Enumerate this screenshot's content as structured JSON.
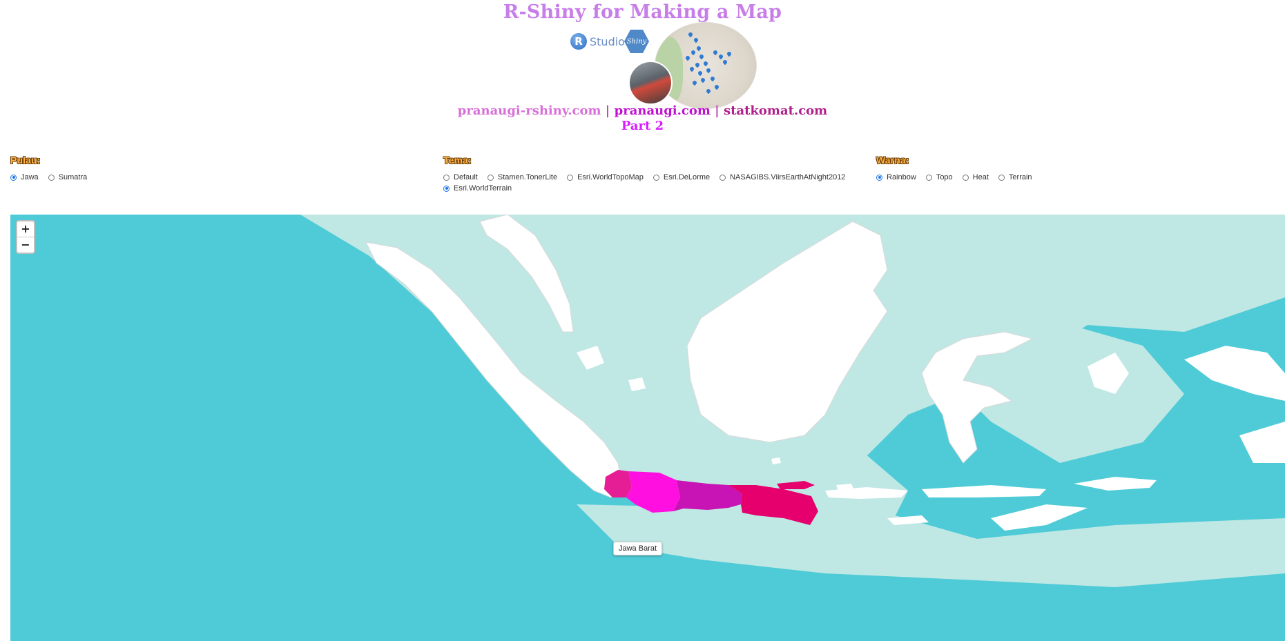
{
  "header": {
    "title": "R-Shiny for Making a Map",
    "rstudio_text": "Studio",
    "rstudio_r": "R",
    "shiny_text": "Shiny",
    "link1": "pranaugi-rshiny.com",
    "sep1": " | ",
    "link2": "pranaugi.com",
    "sep2": " | ",
    "link3": "statkomat.com",
    "part": "Part 2"
  },
  "controls": {
    "pulau": {
      "label": "Pulau:",
      "options": [
        {
          "label": "Jawa",
          "selected": true
        },
        {
          "label": "Sumatra",
          "selected": false
        }
      ]
    },
    "tema": {
      "label": "Tema:",
      "options": [
        {
          "label": "Default",
          "selected": false
        },
        {
          "label": "Stamen.TonerLite",
          "selected": false
        },
        {
          "label": "Esri.WorldTopoMap",
          "selected": false
        },
        {
          "label": "Esri.DeLorme",
          "selected": false
        },
        {
          "label": "NASAGIBS.ViirsEarthAtNight2012",
          "selected": false
        },
        {
          "label": "Esri.WorldTerrain",
          "selected": true
        }
      ]
    },
    "warna": {
      "label": "Warna:",
      "options": [
        {
          "label": "Rainbow",
          "selected": true
        },
        {
          "label": "Topo",
          "selected": false
        },
        {
          "label": "Heat",
          "selected": false
        },
        {
          "label": "Terrain",
          "selected": false
        }
      ]
    }
  },
  "map": {
    "zoom_in": "+",
    "zoom_out": "−",
    "tooltip": "Jawa Barat",
    "colors": {
      "sea_deep": "#4fcbd7",
      "sea_shallow": "#bfe8e4",
      "land": "#ffffff",
      "banten": "#e61e96",
      "jawa_barat": "#ff10e0",
      "jawa_tengah": "#c814b4",
      "jawa_timur": "#e6006e"
    }
  }
}
